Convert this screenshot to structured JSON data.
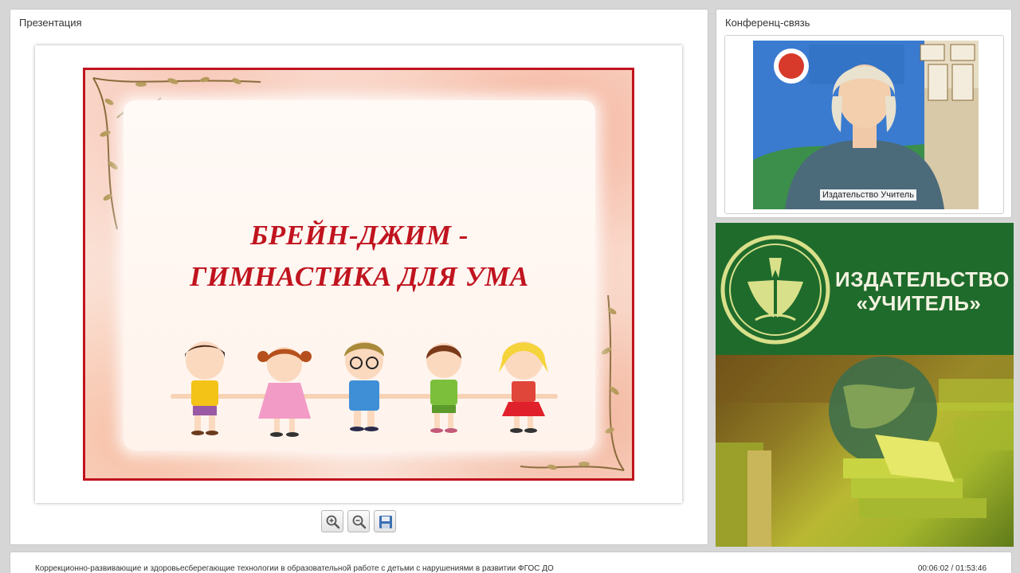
{
  "presentation": {
    "title": "Презентация",
    "slide": {
      "title_line1": "БРЕЙН-ДЖИМ -",
      "title_line2": "ГИМНАСТИКА ДЛЯ УМА"
    },
    "controls": {
      "zoom_in_icon": "zoom-in-icon",
      "zoom_out_icon": "zoom-out-icon",
      "save_icon": "floppy-disk-icon"
    }
  },
  "conference": {
    "title": "Конференц-связь",
    "participant_name": "Издательство Учитель"
  },
  "banner": {
    "line1": "ИЗДАТЕЛЬСТВО",
    "line2": "«УЧИТЕЛЬ»"
  },
  "footer": {
    "title": "Коррекционно-развивающие и здоровьесберегающие технологии в образовательной работе с детьми с нарушениями в развитии ФГОС ДО",
    "time": "00:06:02 / 01:53:46"
  },
  "colors": {
    "slide_border": "#c0141f",
    "banner_green": "#1f6b2c",
    "banner_text": "#f2f2e0"
  }
}
